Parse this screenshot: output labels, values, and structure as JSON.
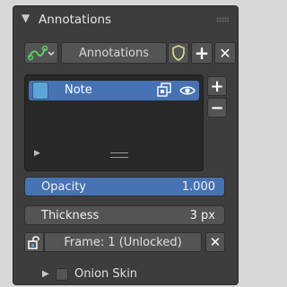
{
  "panel": {
    "title": "Annotations",
    "expanded_icon": "disclosure-triangle-down-icon"
  },
  "toolbar": {
    "mode_icon": "annotation-data-icon",
    "name_value": "Annotations",
    "shield_icon": "fake-user-shield-icon",
    "add_label": "+",
    "remove_label": "✕"
  },
  "layer_list": {
    "items": [
      {
        "label": "Note",
        "color": "#5ba6d6",
        "selected": true,
        "visible": true
      }
    ],
    "add_label": "+",
    "remove_label": "−"
  },
  "opacity": {
    "label": "Opacity",
    "value": "1.000"
  },
  "thickness": {
    "label": "Thickness",
    "value": "3 px"
  },
  "frame": {
    "label": "Frame: 1 (Unlocked)",
    "remove_label": "✕"
  },
  "onion_skin": {
    "label": "Onion Skin",
    "checked": false
  },
  "colors": {
    "accent": "#4772b3",
    "panel_bg": "#3d3d3d",
    "button_bg": "#545454"
  }
}
